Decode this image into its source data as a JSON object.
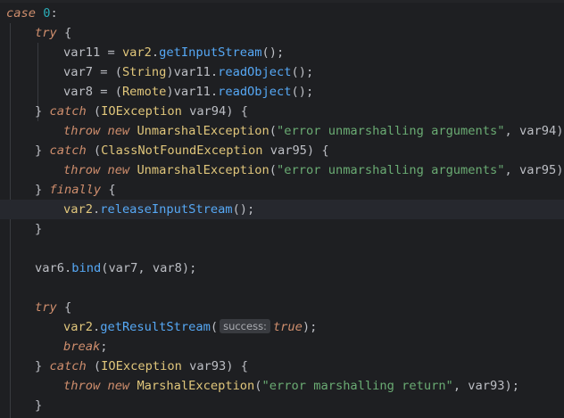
{
  "editor": {
    "lines": [
      {
        "indent": 0,
        "current": false,
        "tokens": [
          {
            "t": "kwi",
            "v": "case"
          },
          {
            "t": "pun",
            "v": " "
          },
          {
            "t": "num",
            "v": "0"
          },
          {
            "t": "pun",
            "v": ":"
          }
        ]
      },
      {
        "indent": 1,
        "current": false,
        "tokens": [
          {
            "t": "kwi",
            "v": "try"
          },
          {
            "t": "pun",
            "v": " {"
          }
        ]
      },
      {
        "indent": 2,
        "current": false,
        "tokens": [
          {
            "t": "id",
            "v": "var11"
          },
          {
            "t": "pun",
            "v": " = "
          },
          {
            "t": "cls",
            "v": "var2"
          },
          {
            "t": "pun",
            "v": "."
          },
          {
            "t": "fn",
            "v": "getInputStream"
          },
          {
            "t": "pun",
            "v": "();"
          }
        ]
      },
      {
        "indent": 2,
        "current": false,
        "tokens": [
          {
            "t": "id",
            "v": "var7"
          },
          {
            "t": "pun",
            "v": " = ("
          },
          {
            "t": "cls",
            "v": "String"
          },
          {
            "t": "pun",
            "v": ")"
          },
          {
            "t": "id",
            "v": "var11"
          },
          {
            "t": "pun",
            "v": "."
          },
          {
            "t": "fn",
            "v": "readObject"
          },
          {
            "t": "pun",
            "v": "();"
          }
        ]
      },
      {
        "indent": 2,
        "current": false,
        "tokens": [
          {
            "t": "id",
            "v": "var8"
          },
          {
            "t": "pun",
            "v": " = ("
          },
          {
            "t": "cls",
            "v": "Remote"
          },
          {
            "t": "pun",
            "v": ")"
          },
          {
            "t": "id",
            "v": "var11"
          },
          {
            "t": "pun",
            "v": "."
          },
          {
            "t": "fn",
            "v": "readObject"
          },
          {
            "t": "pun",
            "v": "();"
          }
        ]
      },
      {
        "indent": 1,
        "current": false,
        "tokens": [
          {
            "t": "pun",
            "v": "} "
          },
          {
            "t": "kwi",
            "v": "catch"
          },
          {
            "t": "pun",
            "v": " ("
          },
          {
            "t": "cls",
            "v": "IOException"
          },
          {
            "t": "pun",
            "v": " "
          },
          {
            "t": "id",
            "v": "var94"
          },
          {
            "t": "pun",
            "v": ") {"
          }
        ]
      },
      {
        "indent": 2,
        "current": false,
        "tokens": [
          {
            "t": "kwi",
            "v": "throw"
          },
          {
            "t": "pun",
            "v": " "
          },
          {
            "t": "kwi",
            "v": "new"
          },
          {
            "t": "pun",
            "v": " "
          },
          {
            "t": "cls",
            "v": "UnmarshalException"
          },
          {
            "t": "pun",
            "v": "("
          },
          {
            "t": "str",
            "v": "\"error unmarshalling arguments\""
          },
          {
            "t": "pun",
            "v": ", "
          },
          {
            "t": "id",
            "v": "var94"
          },
          {
            "t": "pun",
            "v": ");"
          }
        ]
      },
      {
        "indent": 1,
        "current": false,
        "tokens": [
          {
            "t": "pun",
            "v": "} "
          },
          {
            "t": "kwi",
            "v": "catch"
          },
          {
            "t": "pun",
            "v": " ("
          },
          {
            "t": "cls",
            "v": "ClassNotFoundException"
          },
          {
            "t": "pun",
            "v": " "
          },
          {
            "t": "id",
            "v": "var95"
          },
          {
            "t": "pun",
            "v": ") {"
          }
        ]
      },
      {
        "indent": 2,
        "current": false,
        "tokens": [
          {
            "t": "kwi",
            "v": "throw"
          },
          {
            "t": "pun",
            "v": " "
          },
          {
            "t": "kwi",
            "v": "new"
          },
          {
            "t": "pun",
            "v": " "
          },
          {
            "t": "cls",
            "v": "UnmarshalException"
          },
          {
            "t": "pun",
            "v": "("
          },
          {
            "t": "str",
            "v": "\"error unmarshalling arguments\""
          },
          {
            "t": "pun",
            "v": ", "
          },
          {
            "t": "id",
            "v": "var95"
          },
          {
            "t": "pun",
            "v": ");"
          }
        ]
      },
      {
        "indent": 1,
        "current": false,
        "tokens": [
          {
            "t": "pun",
            "v": "} "
          },
          {
            "t": "kwi",
            "v": "finally"
          },
          {
            "t": "pun",
            "v": " {"
          }
        ]
      },
      {
        "indent": 2,
        "current": true,
        "tokens": [
          {
            "t": "cls",
            "v": "var2"
          },
          {
            "t": "pun",
            "v": "."
          },
          {
            "t": "fn",
            "v": "releaseInputStream"
          },
          {
            "t": "pun",
            "v": "();"
          }
        ]
      },
      {
        "indent": 1,
        "current": false,
        "tokens": [
          {
            "t": "pun",
            "v": "}"
          }
        ]
      },
      {
        "indent": 1,
        "current": false,
        "tokens": []
      },
      {
        "indent": 1,
        "current": false,
        "tokens": [
          {
            "t": "id",
            "v": "var6"
          },
          {
            "t": "pun",
            "v": "."
          },
          {
            "t": "fn",
            "v": "bind"
          },
          {
            "t": "pun",
            "v": "("
          },
          {
            "t": "id",
            "v": "var7"
          },
          {
            "t": "pun",
            "v": ", "
          },
          {
            "t": "id",
            "v": "var8"
          },
          {
            "t": "pun",
            "v": ");"
          }
        ]
      },
      {
        "indent": 1,
        "current": false,
        "tokens": []
      },
      {
        "indent": 1,
        "current": false,
        "tokens": [
          {
            "t": "kwi",
            "v": "try"
          },
          {
            "t": "pun",
            "v": " {"
          }
        ]
      },
      {
        "indent": 2,
        "current": false,
        "tokens": [
          {
            "t": "cls",
            "v": "var2"
          },
          {
            "t": "pun",
            "v": "."
          },
          {
            "t": "fn",
            "v": "getResultStream"
          },
          {
            "t": "pun",
            "v": "("
          },
          {
            "t": "hint",
            "v": "success:"
          },
          {
            "t": "kwi",
            "v": "true"
          },
          {
            "t": "pun",
            "v": ");"
          }
        ]
      },
      {
        "indent": 2,
        "current": false,
        "tokens": [
          {
            "t": "kwi",
            "v": "break"
          },
          {
            "t": "pun",
            "v": ";"
          }
        ]
      },
      {
        "indent": 1,
        "current": false,
        "tokens": [
          {
            "t": "pun",
            "v": "} "
          },
          {
            "t": "kwi",
            "v": "catch"
          },
          {
            "t": "pun",
            "v": " ("
          },
          {
            "t": "cls",
            "v": "IOException"
          },
          {
            "t": "pun",
            "v": " "
          },
          {
            "t": "id",
            "v": "var93"
          },
          {
            "t": "pun",
            "v": ") {"
          }
        ]
      },
      {
        "indent": 2,
        "current": false,
        "tokens": [
          {
            "t": "kwi",
            "v": "throw"
          },
          {
            "t": "pun",
            "v": " "
          },
          {
            "t": "kwi",
            "v": "new"
          },
          {
            "t": "pun",
            "v": " "
          },
          {
            "t": "cls",
            "v": "MarshalException"
          },
          {
            "t": "pun",
            "v": "("
          },
          {
            "t": "str",
            "v": "\"error marshalling return\""
          },
          {
            "t": "pun",
            "v": ", "
          },
          {
            "t": "id",
            "v": "var93"
          },
          {
            "t": "pun",
            "v": ");"
          }
        ]
      },
      {
        "indent": 1,
        "current": false,
        "tokens": [
          {
            "t": "pun",
            "v": "}"
          }
        ]
      }
    ]
  },
  "colors": {
    "background": "#1e1f22",
    "keyword": "#cf8e6d",
    "number": "#2aacb8",
    "string": "#6aab73",
    "method": "#56a8f5",
    "class": "#bcbec4",
    "identifier": "#bcbec4",
    "current_line": "#26282e"
  }
}
